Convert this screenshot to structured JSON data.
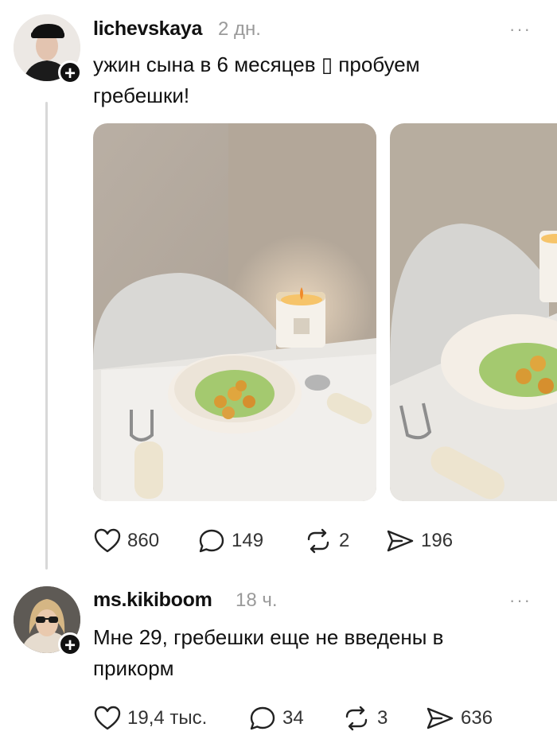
{
  "post": {
    "username": "lichevskaya",
    "time": "2 дн.",
    "more": "···",
    "text_line1": "ужин сына в 6 месяцев ▯ пробуем",
    "text_line2": "гребешки!",
    "likes": "860",
    "comments": "149",
    "reposts": "2",
    "shares": "196"
  },
  "reply": {
    "username": "ms.kikiboom",
    "time": "18 ч.",
    "more": "···",
    "text_line1": "Мне 29, гребешки еще не введены в",
    "text_line2": "прикорм",
    "likes": "19,4 тыс.",
    "comments": "34",
    "reposts": "3",
    "shares": "636"
  },
  "icons": [
    "heart-icon",
    "comment-icon",
    "repost-icon",
    "share-icon",
    "plus-icon",
    "more-icon"
  ],
  "colors": {
    "text": "#111111",
    "muted": "#9a9a9a",
    "line": "#d8d8d8"
  }
}
